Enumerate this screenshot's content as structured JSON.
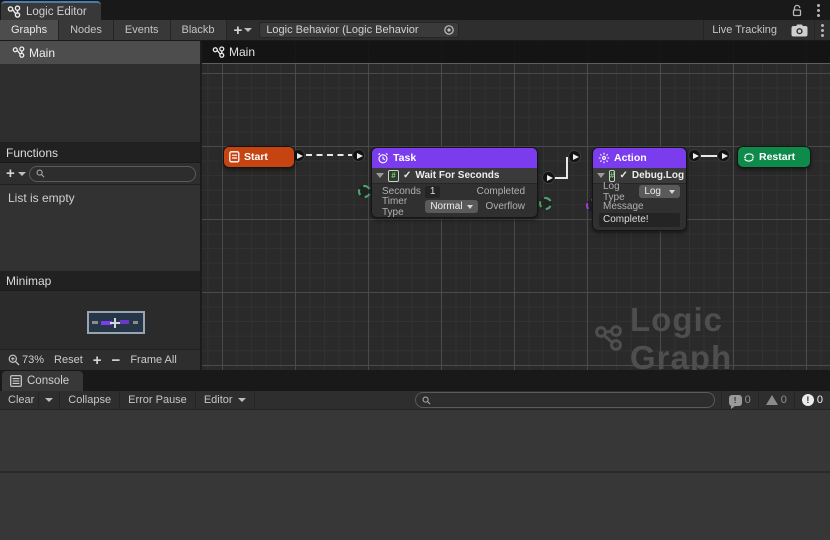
{
  "window": {
    "title": "Logic Editor"
  },
  "toolbar": {
    "tabs": [
      {
        "label": "Graphs"
      },
      {
        "label": "Nodes"
      },
      {
        "label": "Events"
      },
      {
        "label": "Blackb"
      }
    ],
    "add_label": "+",
    "object_field": "Logic Behavior (Logic Behavior",
    "live_tracking_label": "Live Tracking"
  },
  "sidebar": {
    "graphs": [
      {
        "label": "Main"
      }
    ],
    "functions_header": "Functions",
    "add_label": "+",
    "empty_text": "List is empty",
    "minimap_header": "Minimap",
    "zoom_controls": {
      "zoom_level": "73%",
      "reset": "Reset",
      "zoom_in": "+",
      "zoom_out": "−",
      "frame_all": "Frame All"
    }
  },
  "canvas": {
    "breadcrumb": "Main",
    "watermark": "Logic Graph"
  },
  "nodes": {
    "start": {
      "title": "Start"
    },
    "task": {
      "title": "Task",
      "unit_title": "Wait For Seconds",
      "seconds_label": "Seconds",
      "seconds_value": "1",
      "timer_type_label": "Timer Type",
      "timer_type_value": "Normal",
      "completed_label": "Completed",
      "overflow_label": "Overflow"
    },
    "action": {
      "title": "Action",
      "unit_title": "Debug.Log",
      "log_type_label": "Log Type",
      "log_type_value": "Log",
      "message_label": "Message",
      "message_value": "Complete!"
    },
    "restart": {
      "title": "Restart"
    }
  },
  "console": {
    "tab": "Console",
    "clear_label": "Clear",
    "collapse_label": "Collapse",
    "error_pause_label": "Error Pause",
    "editor_label": "Editor",
    "info_count": "0",
    "warning_count": "0",
    "error_count": "0"
  },
  "colors": {
    "tab_accent": "#497cab",
    "start_node": "#c64411",
    "event_purple": "#7a3ced",
    "restart_green": "#0e8a4a",
    "port_green": "#4aa96c",
    "port_purple": "#9b3fd6",
    "watermark": "#4e4e4e"
  }
}
